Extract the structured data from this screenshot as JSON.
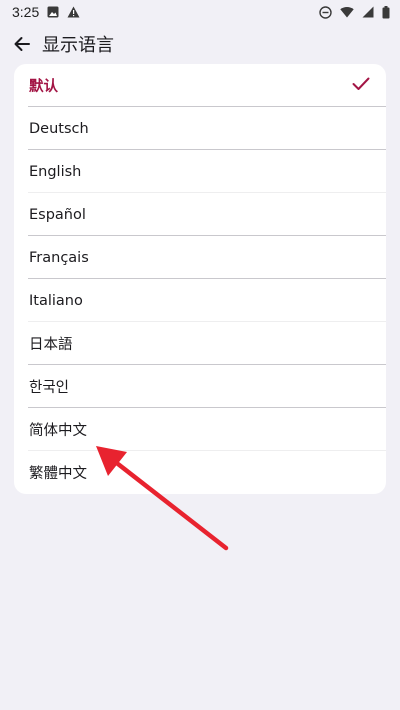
{
  "status_bar": {
    "time": "3:25"
  },
  "app_bar": {
    "title": "显示语言"
  },
  "languages": [
    {
      "label": "默认",
      "selected": true
    },
    {
      "label": "Deutsch",
      "selected": false
    },
    {
      "label": "English",
      "selected": false
    },
    {
      "label": "Español",
      "selected": false
    },
    {
      "label": "Français",
      "selected": false
    },
    {
      "label": "Italiano",
      "selected": false
    },
    {
      "label": "日本語",
      "selected": false
    },
    {
      "label": "한국인",
      "selected": false
    },
    {
      "label": "简体中文",
      "selected": false
    },
    {
      "label": "繁體中文",
      "selected": false
    }
  ],
  "colors": {
    "background": "#f1f0f6",
    "card": "#ffffff",
    "accent": "#a31545",
    "annotation_arrow": "#e8232f"
  },
  "icons": {
    "back": "arrow-left-icon",
    "check": "check-icon"
  }
}
